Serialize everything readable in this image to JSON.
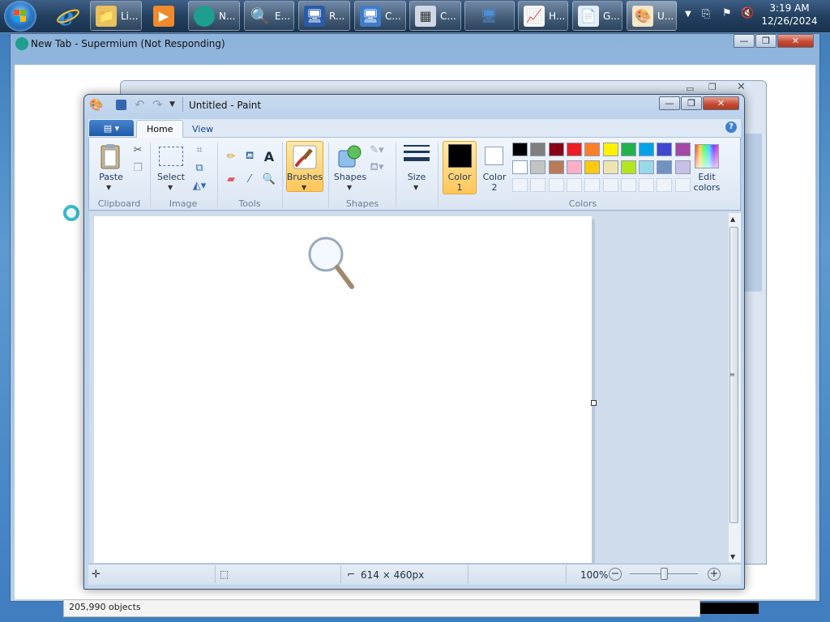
{
  "taskbar": {
    "buttons": [
      {
        "label": "Li...",
        "icon": "folder-icon"
      },
      {
        "label": "",
        "icon": "media-player-icon"
      },
      {
        "label": "N...",
        "icon": "supermium-browser-icon"
      },
      {
        "label": "E...",
        "icon": "search-everything-icon"
      },
      {
        "label": "R...",
        "icon": "remote-desktop-icon"
      },
      {
        "label": "C...",
        "icon": "control-panel-icon"
      },
      {
        "label": "C...",
        "icon": "calculator-icon"
      },
      {
        "label": "",
        "icon": "network-computer-icon"
      },
      {
        "label": "H...",
        "icon": "chart-app-icon"
      },
      {
        "label": "G...",
        "icon": "document-icon"
      },
      {
        "label": "U...",
        "icon": "paint-icon"
      }
    ],
    "clock": {
      "time": "3:19 AM",
      "date": "12/26/2024"
    }
  },
  "browser_window": {
    "title": "New Tab - Supermium (Not Responding)",
    "status_text": "205,990 objects"
  },
  "paint": {
    "title": "Untitled - Paint",
    "tabs": [
      "Home",
      "View"
    ],
    "groups": {
      "clipboard": "Clipboard",
      "image": "Image",
      "tools": "Tools",
      "shapes": "Shapes",
      "colors": "Colors"
    },
    "buttons": {
      "paste": "Paste",
      "select": "Select",
      "brushes": "Brushes",
      "shapes": "Shapes",
      "size": "Size",
      "color1_line1": "Color",
      "color1_line2": "1",
      "color2_line1": "Color",
      "color2_line2": "2",
      "edit_colors_line1": "Edit",
      "edit_colors_line2": "colors"
    },
    "palette_row1": [
      "#000000",
      "#7f7f7f",
      "#880015",
      "#ed1c24",
      "#ff7f27",
      "#fff200",
      "#22b14c",
      "#00a2e8",
      "#3f48cc",
      "#a349a4"
    ],
    "palette_row2": [
      "#ffffff",
      "#c3c3c3",
      "#b97a57",
      "#ffaec9",
      "#ffc90e",
      "#efe4b0",
      "#b5e61d",
      "#99d9ea",
      "#7092be",
      "#c8bfe7"
    ],
    "color1": "#000000",
    "color2": "#ffffff",
    "status": {
      "dimensions": "614 × 460px",
      "zoom": "100%"
    }
  }
}
